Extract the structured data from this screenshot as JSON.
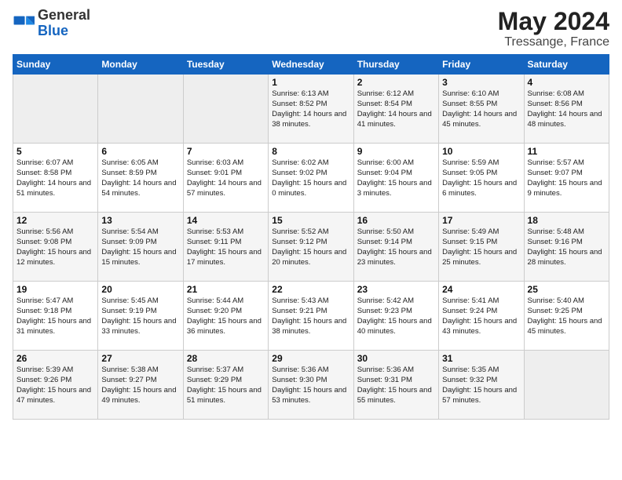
{
  "header": {
    "logo_general": "General",
    "logo_blue": "Blue",
    "month": "May 2024",
    "location": "Tressange, France"
  },
  "weekdays": [
    "Sunday",
    "Monday",
    "Tuesday",
    "Wednesday",
    "Thursday",
    "Friday",
    "Saturday"
  ],
  "weeks": [
    [
      {
        "day": "",
        "empty": true
      },
      {
        "day": "",
        "empty": true
      },
      {
        "day": "",
        "empty": true
      },
      {
        "day": "1",
        "sunrise": "6:13 AM",
        "sunset": "8:52 PM",
        "daylight": "14 hours and 38 minutes."
      },
      {
        "day": "2",
        "sunrise": "6:12 AM",
        "sunset": "8:54 PM",
        "daylight": "14 hours and 41 minutes."
      },
      {
        "day": "3",
        "sunrise": "6:10 AM",
        "sunset": "8:55 PM",
        "daylight": "14 hours and 45 minutes."
      },
      {
        "day": "4",
        "sunrise": "6:08 AM",
        "sunset": "8:56 PM",
        "daylight": "14 hours and 48 minutes."
      }
    ],
    [
      {
        "day": "5",
        "sunrise": "6:07 AM",
        "sunset": "8:58 PM",
        "daylight": "14 hours and 51 minutes."
      },
      {
        "day": "6",
        "sunrise": "6:05 AM",
        "sunset": "8:59 PM",
        "daylight": "14 hours and 54 minutes."
      },
      {
        "day": "7",
        "sunrise": "6:03 AM",
        "sunset": "9:01 PM",
        "daylight": "14 hours and 57 minutes."
      },
      {
        "day": "8",
        "sunrise": "6:02 AM",
        "sunset": "9:02 PM",
        "daylight": "15 hours and 0 minutes."
      },
      {
        "day": "9",
        "sunrise": "6:00 AM",
        "sunset": "9:04 PM",
        "daylight": "15 hours and 3 minutes."
      },
      {
        "day": "10",
        "sunrise": "5:59 AM",
        "sunset": "9:05 PM",
        "daylight": "15 hours and 6 minutes."
      },
      {
        "day": "11",
        "sunrise": "5:57 AM",
        "sunset": "9:07 PM",
        "daylight": "15 hours and 9 minutes."
      }
    ],
    [
      {
        "day": "12",
        "sunrise": "5:56 AM",
        "sunset": "9:08 PM",
        "daylight": "15 hours and 12 minutes."
      },
      {
        "day": "13",
        "sunrise": "5:54 AM",
        "sunset": "9:09 PM",
        "daylight": "15 hours and 15 minutes."
      },
      {
        "day": "14",
        "sunrise": "5:53 AM",
        "sunset": "9:11 PM",
        "daylight": "15 hours and 17 minutes."
      },
      {
        "day": "15",
        "sunrise": "5:52 AM",
        "sunset": "9:12 PM",
        "daylight": "15 hours and 20 minutes."
      },
      {
        "day": "16",
        "sunrise": "5:50 AM",
        "sunset": "9:14 PM",
        "daylight": "15 hours and 23 minutes."
      },
      {
        "day": "17",
        "sunrise": "5:49 AM",
        "sunset": "9:15 PM",
        "daylight": "15 hours and 25 minutes."
      },
      {
        "day": "18",
        "sunrise": "5:48 AM",
        "sunset": "9:16 PM",
        "daylight": "15 hours and 28 minutes."
      }
    ],
    [
      {
        "day": "19",
        "sunrise": "5:47 AM",
        "sunset": "9:18 PM",
        "daylight": "15 hours and 31 minutes."
      },
      {
        "day": "20",
        "sunrise": "5:45 AM",
        "sunset": "9:19 PM",
        "daylight": "15 hours and 33 minutes."
      },
      {
        "day": "21",
        "sunrise": "5:44 AM",
        "sunset": "9:20 PM",
        "daylight": "15 hours and 36 minutes."
      },
      {
        "day": "22",
        "sunrise": "5:43 AM",
        "sunset": "9:21 PM",
        "daylight": "15 hours and 38 minutes."
      },
      {
        "day": "23",
        "sunrise": "5:42 AM",
        "sunset": "9:23 PM",
        "daylight": "15 hours and 40 minutes."
      },
      {
        "day": "24",
        "sunrise": "5:41 AM",
        "sunset": "9:24 PM",
        "daylight": "15 hours and 43 minutes."
      },
      {
        "day": "25",
        "sunrise": "5:40 AM",
        "sunset": "9:25 PM",
        "daylight": "15 hours and 45 minutes."
      }
    ],
    [
      {
        "day": "26",
        "sunrise": "5:39 AM",
        "sunset": "9:26 PM",
        "daylight": "15 hours and 47 minutes."
      },
      {
        "day": "27",
        "sunrise": "5:38 AM",
        "sunset": "9:27 PM",
        "daylight": "15 hours and 49 minutes."
      },
      {
        "day": "28",
        "sunrise": "5:37 AM",
        "sunset": "9:29 PM",
        "daylight": "15 hours and 51 minutes."
      },
      {
        "day": "29",
        "sunrise": "5:36 AM",
        "sunset": "9:30 PM",
        "daylight": "15 hours and 53 minutes."
      },
      {
        "day": "30",
        "sunrise": "5:36 AM",
        "sunset": "9:31 PM",
        "daylight": "15 hours and 55 minutes."
      },
      {
        "day": "31",
        "sunrise": "5:35 AM",
        "sunset": "9:32 PM",
        "daylight": "15 hours and 57 minutes."
      },
      {
        "day": "",
        "empty": true
      }
    ]
  ]
}
